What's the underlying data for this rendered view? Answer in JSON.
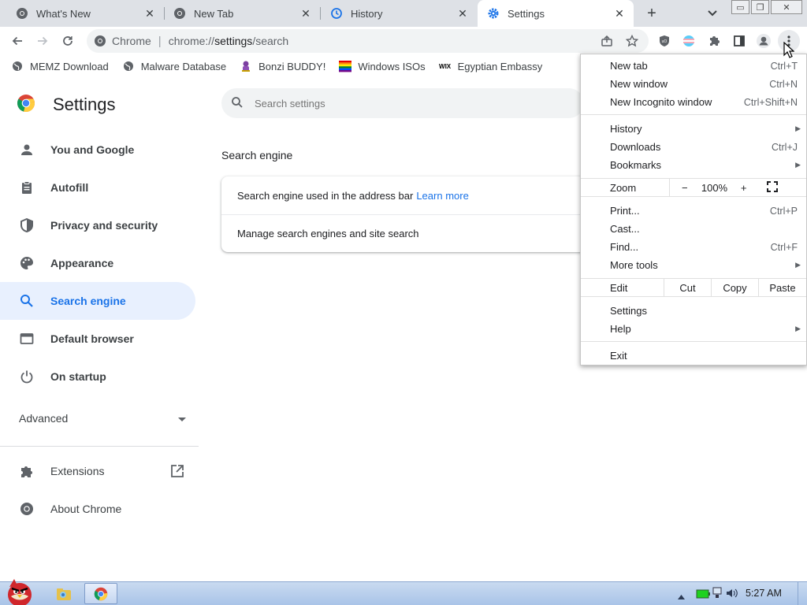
{
  "tabs": [
    {
      "title": "What's New"
    },
    {
      "title": "New Tab"
    },
    {
      "title": "History"
    },
    {
      "title": "Settings"
    }
  ],
  "toolbar": {
    "chip": "Chrome",
    "url_scheme": "chrome://",
    "url_host": "settings",
    "url_path": "/search"
  },
  "bookmarks": [
    {
      "label": "MEMZ Download"
    },
    {
      "label": "Malware Database"
    },
    {
      "label": "Bonzi BUDDY!"
    },
    {
      "label": "Windows ISOs"
    },
    {
      "label": "Egyptian Embassy"
    }
  ],
  "bookmark_icon_text": {
    "wix": "WIX"
  },
  "settings": {
    "title": "Settings",
    "search_placeholder": "Search settings",
    "nav": [
      {
        "label": "You and Google"
      },
      {
        "label": "Autofill"
      },
      {
        "label": "Privacy and security"
      },
      {
        "label": "Appearance"
      },
      {
        "label": "Search engine"
      },
      {
        "label": "Default browser"
      },
      {
        "label": "On startup"
      }
    ],
    "advanced": "Advanced",
    "extensions": "Extensions",
    "about": "About Chrome",
    "section_title": "Search engine",
    "row1_text": "Search engine used in the address bar",
    "row1_link": "Learn more",
    "row2_text": "Manage search engines and site search"
  },
  "menu": {
    "new_tab": "New tab",
    "new_tab_sc": "Ctrl+T",
    "new_window": "New window",
    "new_window_sc": "Ctrl+N",
    "incognito": "New Incognito window",
    "incognito_sc": "Ctrl+Shift+N",
    "history": "History",
    "downloads": "Downloads",
    "downloads_sc": "Ctrl+J",
    "bookmarks": "Bookmarks",
    "zoom": "Zoom",
    "zoom_minus": "−",
    "zoom_value": "100%",
    "zoom_plus": "+",
    "print": "Print...",
    "print_sc": "Ctrl+P",
    "cast": "Cast...",
    "find": "Find...",
    "find_sc": "Ctrl+F",
    "more_tools": "More tools",
    "edit": "Edit",
    "cut": "Cut",
    "copy": "Copy",
    "paste": "Paste",
    "settings": "Settings",
    "help": "Help",
    "exit": "Exit"
  },
  "taskbar": {
    "time": "5:27 AM"
  }
}
